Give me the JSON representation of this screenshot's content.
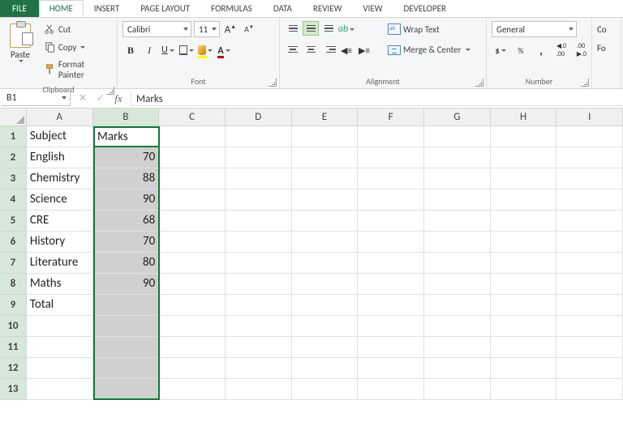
{
  "tabs": {
    "file": "FILE",
    "home": "HOME",
    "insert": "INSERT",
    "pagelayout": "PAGE LAYOUT",
    "formulas": "FORMULAS",
    "data": "DATA",
    "review": "REVIEW",
    "view": "VIEW",
    "developer": "DEVELOPER"
  },
  "clipboard": {
    "paste": "Paste",
    "cut": "Cut",
    "copy": "Copy",
    "fmtpainter": "Format Painter",
    "label": "Clipboard"
  },
  "font": {
    "name": "Calibri",
    "size": "11",
    "label": "Font",
    "bold": "B",
    "italic": "I",
    "underline": "U",
    "fontcolor": "A"
  },
  "alignment": {
    "wrap": "Wrap Text",
    "merge": "Merge & Center",
    "label": "Alignment"
  },
  "number": {
    "general": "General",
    "dollar": "$",
    "percent": "%",
    "comma": ",",
    "inc": ".0",
    "dec": ".00",
    "label": "Number"
  },
  "cells_trunc": {
    "cond": "Co",
    "fo": "Fo"
  },
  "formula_bar": {
    "cellref": "B1",
    "value": "Marks"
  },
  "columns": [
    "A",
    "B",
    "C",
    "D",
    "E",
    "F",
    "G",
    "H",
    "I"
  ],
  "rows": [
    "1",
    "2",
    "3",
    "4",
    "5",
    "6",
    "7",
    "8",
    "9",
    "10",
    "11",
    "12",
    "13"
  ],
  "sheet": {
    "A": [
      "Subject",
      "English",
      "Chemistry",
      "Science",
      "CRE",
      "History",
      "Literature",
      "Maths",
      "Total",
      "",
      "",
      "",
      ""
    ],
    "B": [
      "Marks",
      "70",
      "88",
      "90",
      "68",
      "70",
      "80",
      "90",
      "",
      "",
      "",
      "",
      ""
    ]
  },
  "chart_data": {
    "type": "table",
    "title": "Subject marks",
    "columns": [
      "Subject",
      "Marks"
    ],
    "rows": [
      [
        "English",
        70
      ],
      [
        "Chemistry",
        88
      ],
      [
        "Science",
        90
      ],
      [
        "CRE",
        68
      ],
      [
        "History",
        70
      ],
      [
        "Literature",
        80
      ],
      [
        "Maths",
        90
      ]
    ],
    "footer": [
      "Total",
      null
    ]
  }
}
